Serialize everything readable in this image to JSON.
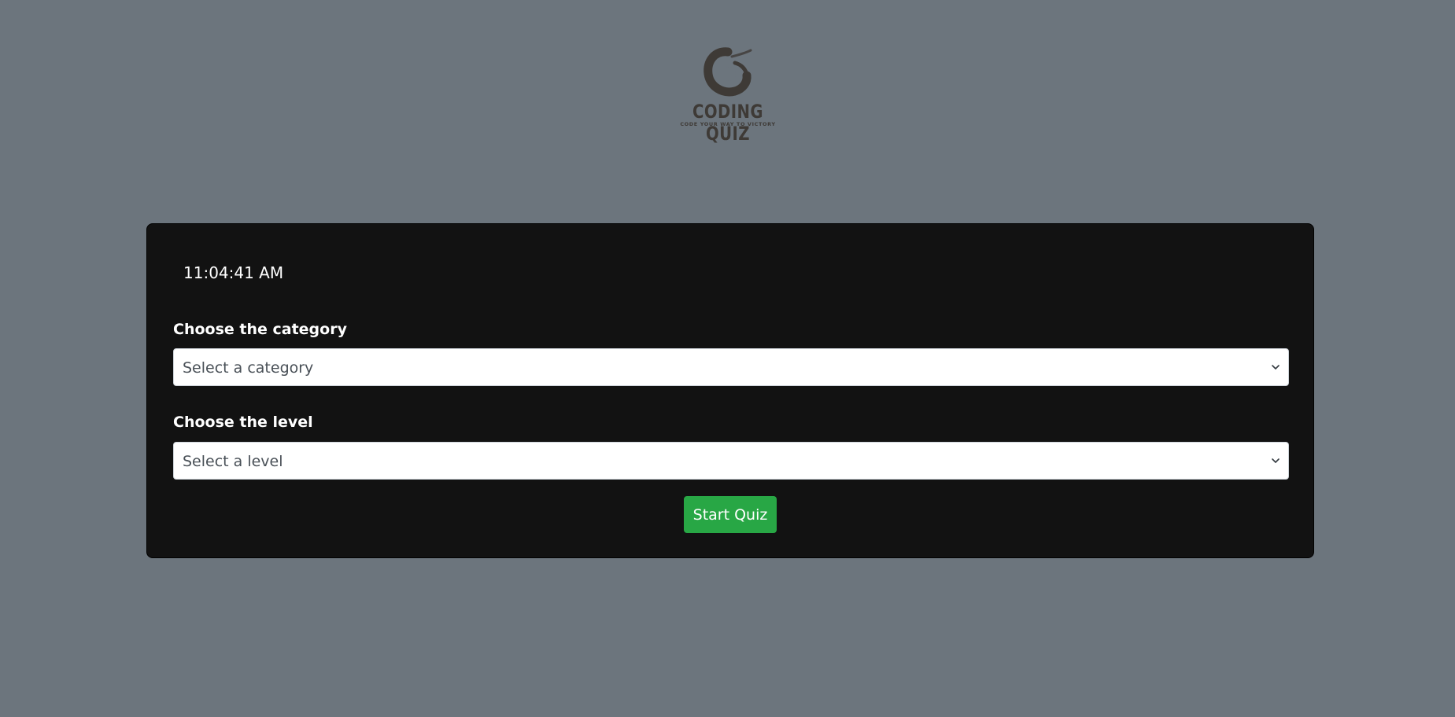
{
  "logo": {
    "title": "CODING QUIZ",
    "tagline": "CODE YOUR WAY TO VICTORY",
    "icon": "brush-circle-logo-icon",
    "color": "#3e3a36"
  },
  "panel": {
    "clock": "11:04:41 AM",
    "category": {
      "label": "Choose the category",
      "selected": "Select a category"
    },
    "level": {
      "label": "Choose the level",
      "selected": "Select a level"
    },
    "start_label": "Start Quiz"
  },
  "colors": {
    "page_background": "#6c757d",
    "panel_background": "#121212",
    "button_background": "#28a745",
    "text_light": "#ffffff",
    "select_text": "#495057"
  },
  "icons": {
    "dropdown": "chevron-down-icon"
  }
}
